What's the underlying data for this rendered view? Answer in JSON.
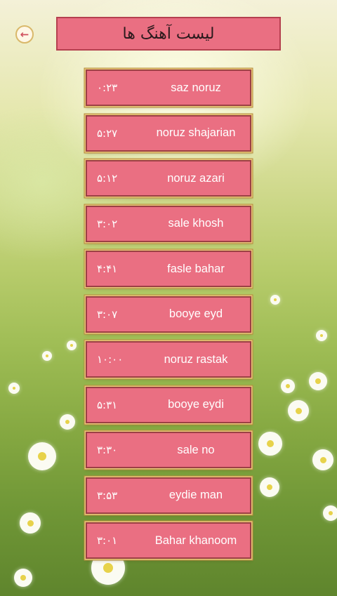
{
  "header": {
    "title": "لیست آهنگ ها"
  },
  "icons": {
    "back": "arrow-left-icon"
  },
  "colors": {
    "item_bg": "#ea6f82",
    "item_border": "#9c4044",
    "gold_trim": "#e8c77a",
    "text": "#ffffff"
  },
  "songs": [
    {
      "name": "saz noruz",
      "duration": "۰:۲۳"
    },
    {
      "name": "noruz shajarian",
      "duration": "۵:۲۷"
    },
    {
      "name": "noruz azari",
      "duration": "۵:۱۲"
    },
    {
      "name": "sale khosh",
      "duration": "۳:۰۲"
    },
    {
      "name": "fasle bahar",
      "duration": "۴:۴۱"
    },
    {
      "name": "booye eyd",
      "duration": "۳:۰۷"
    },
    {
      "name": "noruz rastak",
      "duration": "۱۰:۰۰"
    },
    {
      "name": "booye eydi",
      "duration": "۵:۳۱"
    },
    {
      "name": "sale no",
      "duration": "۳:۳۰"
    },
    {
      "name": "eydie man",
      "duration": "۳:۵۳"
    },
    {
      "name": "Bahar khanoom",
      "duration": "۳:۰۱"
    }
  ]
}
